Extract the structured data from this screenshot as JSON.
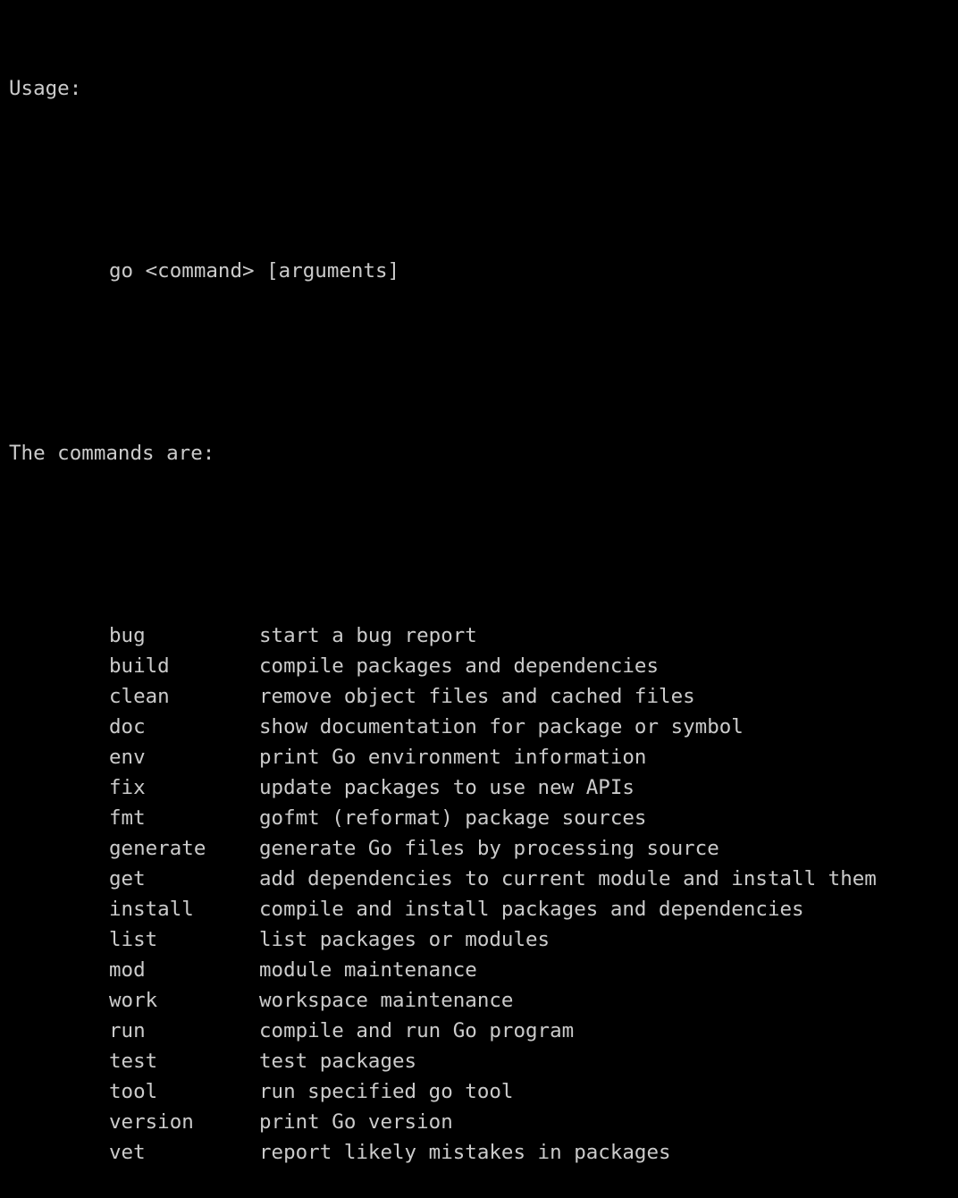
{
  "usage_label": "Usage:",
  "usage_syntax": "go <command> [arguments]",
  "commands_heading": "The commands are:",
  "commands": [
    {
      "name": "bug",
      "description": "start a bug report"
    },
    {
      "name": "build",
      "description": "compile packages and dependencies"
    },
    {
      "name": "clean",
      "description": "remove object files and cached files"
    },
    {
      "name": "doc",
      "description": "show documentation for package or symbol"
    },
    {
      "name": "env",
      "description": "print Go environment information"
    },
    {
      "name": "fix",
      "description": "update packages to use new APIs"
    },
    {
      "name": "fmt",
      "description": "gofmt (reformat) package sources"
    },
    {
      "name": "generate",
      "description": "generate Go files by processing source"
    },
    {
      "name": "get",
      "description": "add dependencies to current module and install them"
    },
    {
      "name": "install",
      "description": "compile and install packages and dependencies"
    },
    {
      "name": "list",
      "description": "list packages or modules"
    },
    {
      "name": "mod",
      "description": "module maintenance"
    },
    {
      "name": "work",
      "description": "workspace maintenance"
    },
    {
      "name": "run",
      "description": "compile and run Go program"
    },
    {
      "name": "test",
      "description": "test packages"
    },
    {
      "name": "tool",
      "description": "run specified go tool"
    },
    {
      "name": "version",
      "description": "print Go version"
    },
    {
      "name": "vet",
      "description": "report likely mistakes in packages"
    }
  ]
}
